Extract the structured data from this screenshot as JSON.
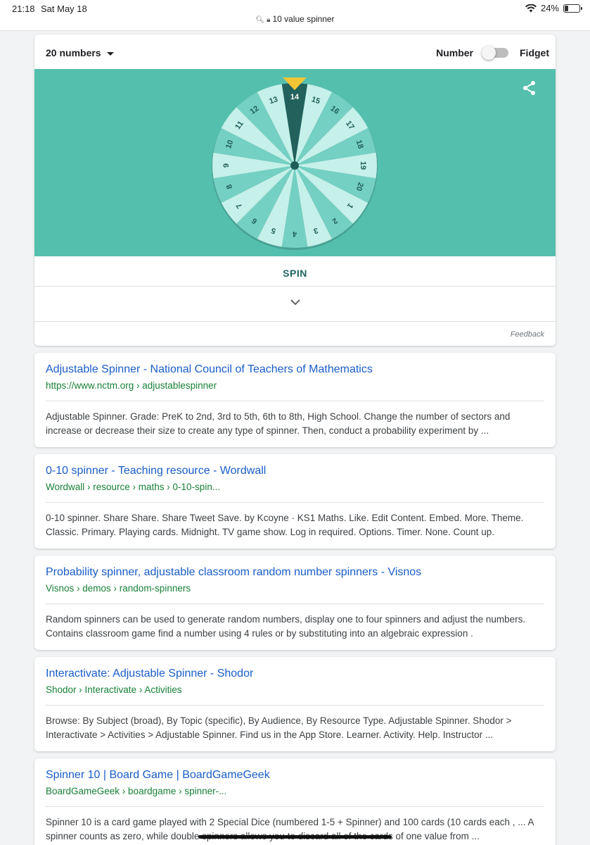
{
  "status_bar": {
    "time": "21:18",
    "date": "Sat May 18",
    "url": "10 value spinner",
    "battery": "24%",
    "battery_level": 0.24
  },
  "spinner": {
    "count_label": "20 numbers",
    "mode_left": "Number",
    "mode_right": "Fidget",
    "fidget_enabled": false,
    "numbers": [
      14,
      15,
      16,
      17,
      18,
      19,
      20,
      1,
      2,
      3,
      4,
      5,
      6,
      7,
      8,
      9,
      10,
      11,
      12,
      13
    ],
    "selected": 14,
    "spin_label": "SPIN",
    "feedback_label": "Feedback",
    "colors": {
      "background": "#55bfae",
      "sector_light": "#c6f0ea",
      "sector_mid": "#74d0c2",
      "sector_selected": "#22615c",
      "pointer": "#f4c636"
    }
  },
  "results": [
    {
      "title": "Adjustable Spinner - National Council of Teachers of Mathematics",
      "url": "https://www.nctm.org › adjustablespinner",
      "snippet": "Adjustable Spinner. Grade: PreK to 2nd, 3rd to 5th, 6th to 8th, High School. Change the number of sectors and increase or decrease their size to create any type of spinner. Then, conduct a probability experiment by ..."
    },
    {
      "title": "0-10 spinner - Teaching resource - Wordwall",
      "url": "Wordwall › resource › maths › 0-10-spin...",
      "snippet": "0-10 spinner. Share Share. Share Tweet Save. by Kcoyne · KS1 Maths. Like. Edit Content. Embed. More. Theme. Classic. Primary. Playing cards. Midnight. TV game show. Log in required. Options. Timer. None. Count up."
    },
    {
      "title": "Probability spinner, adjustable classroom random number spinners - Visnos",
      "url": "Visnos › demos › random-spinners",
      "snippet": "Random spinners can be used to generate random numbers, display one to four spinners and adjust the numbers. Contains classroom game find a number using 4 rules or by substituting into an algebraic expression ."
    },
    {
      "title": "Interactivate: Adjustable Spinner - Shodor",
      "url": "Shodor › Interactivate › Activities",
      "snippet": "Browse: By Subject (broad), By Topic (specific), By Audience, By Resource Type. Adjustable Spinner. Shodor > Interactivate > Activities > Adjustable Spinner. Find us in the App Store. Learner. Activity. Help. Instructor ..."
    },
    {
      "title": "Spinner 10 | Board Game | BoardGameGeek",
      "url": "BoardGameGeek › boardgame › spinner-...",
      "snippet": "Spinner 10 is a card game played with 2 Special Dice (numbered 1-5 + Spinner) and 100 cards (10 cards each , ... A spinner counts as zero, while double spinners allows you to discard all of the cards of one value from ..."
    }
  ]
}
